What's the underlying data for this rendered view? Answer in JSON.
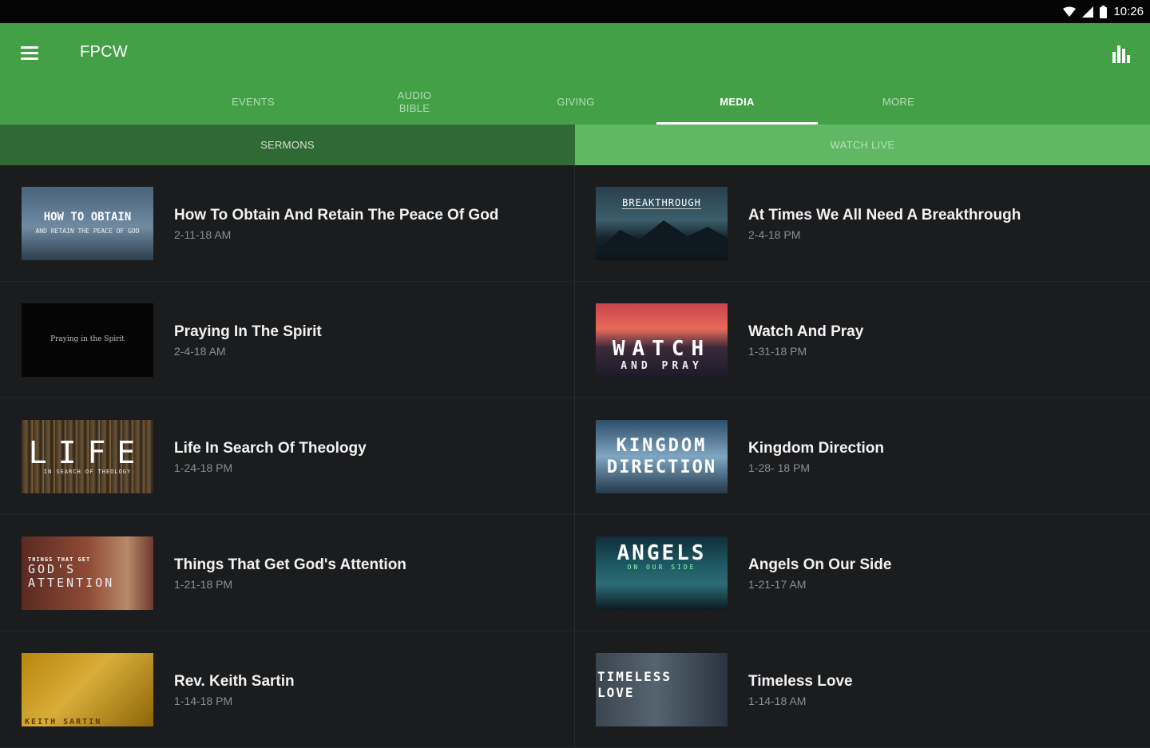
{
  "status": {
    "time": "10:26"
  },
  "app": {
    "title": "FPCW"
  },
  "tabs": [
    {
      "label": "EVENTS"
    },
    {
      "label": "AUDIO\nBIBLE"
    },
    {
      "label": "GIVING"
    },
    {
      "label": "MEDIA"
    },
    {
      "label": "MORE"
    }
  ],
  "subtabs": {
    "sermons": "SERMONS",
    "watch_live": "WATCH LIVE"
  },
  "sermons": [
    {
      "title": "How To Obtain And Retain The Peace Of God",
      "date": "2-11-18 AM",
      "thumb_line1": "HOW TO OBTAIN",
      "thumb_line2": "AND RETAIN THE PEACE OF GOD"
    },
    {
      "title": "At Times We All Need A Breakthrough",
      "date": "2-4-18 PM",
      "thumb_line1": "BREAKTHROUGH",
      "thumb_line2": ""
    },
    {
      "title": "Praying In The Spirit",
      "date": "2-4-18 AM",
      "thumb_line1": "",
      "thumb_line2": "Praying in the Spirit"
    },
    {
      "title": "Watch And Pray",
      "date": "1-31-18 PM",
      "thumb_line1": "WATCH",
      "thumb_line2": "AND PRAY"
    },
    {
      "title": "Life In Search Of Theology",
      "date": "1-24-18 PM",
      "thumb_line1": "LIFE",
      "thumb_line2": "IN SEARCH OF THEOLOGY"
    },
    {
      "title": "Kingdom Direction",
      "date": "1-28- 18 PM",
      "thumb_line1": "KINGDOM",
      "thumb_line2": "DIRECTION"
    },
    {
      "title": "Things That Get God's Attention",
      "date": "1-21-18 PM",
      "thumb_line1": "THINGS THAT GET",
      "thumb_line2": "GOD'S ATTENTION"
    },
    {
      "title": "Angels On Our Side",
      "date": "1-21-17 AM",
      "thumb_line1": "ANGELS",
      "thumb_line2": "ON OUR SIDE"
    },
    {
      "title": "Rev. Keith Sartin",
      "date": "1-14-18 PM",
      "thumb_line1": "",
      "thumb_line2": "KEITH SARTIN"
    },
    {
      "title": "Timeless Love",
      "date": "1-14-18 AM",
      "thumb_line1": "TIMELESS",
      "thumb_line2": "LOVE"
    }
  ]
}
